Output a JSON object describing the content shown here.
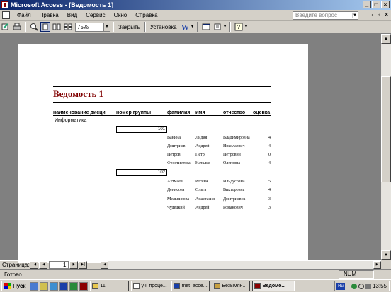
{
  "window": {
    "title": "Microsoft Access - [Ведомость 1]",
    "controls": {
      "minimize": "_",
      "maximize": "□",
      "close": "×"
    }
  },
  "menu": {
    "items": [
      "Файл",
      "Правка",
      "Вид",
      "Сервис",
      "Окно",
      "Справка"
    ],
    "ask_placeholder": "Введите вопрос",
    "window_controls": [
      "-",
      "♂",
      "×"
    ]
  },
  "toolbar": {
    "zoom_value": "75%",
    "close_label": "Закрыть",
    "setup_label": "Установка"
  },
  "report": {
    "title": "Ведомость 1",
    "headers": [
      "наименование дисци",
      "номер группы",
      "фамилия",
      "имя",
      "отчество",
      "оценка"
    ],
    "subject": "Информатика",
    "groups": [
      {
        "number": "101",
        "students": [
          {
            "last": "Ванина",
            "first": "Лидия",
            "middle": "Владимировна",
            "grade": "4"
          },
          {
            "last": "Дмитриев",
            "first": "Андрей",
            "middle": "Николаевич",
            "grade": "4"
          },
          {
            "last": "Петров",
            "first": "Петр",
            "middle": "Петрович",
            "grade": "0"
          },
          {
            "last": "Феоктистова",
            "first": "Наталья",
            "middle": "Олеговна",
            "grade": "4"
          }
        ]
      },
      {
        "number": "102",
        "students": [
          {
            "last": "Ахтмаев",
            "first": "Регина",
            "middle": "Ильдусовна",
            "grade": "5"
          },
          {
            "last": "Денисова",
            "first": "Ольга",
            "middle": "Викторовна",
            "grade": "4"
          },
          {
            "last": "Мельникова",
            "first": "Анастасия",
            "middle": "Дмитриевна",
            "grade": "3"
          },
          {
            "last": "Чудецкий",
            "first": "Андрей",
            "middle": "Романович",
            "grade": "3"
          }
        ]
      }
    ]
  },
  "pager": {
    "label": "Страница:",
    "current": "1"
  },
  "status": {
    "text": "Готово",
    "num": "NUM"
  },
  "taskbar": {
    "start": "Пуск",
    "tasks": [
      "11",
      "уч_проце...",
      "met_acce...",
      "Безымян...",
      "Ведомо..."
    ],
    "tray_lang": "Ru",
    "clock": "13:55"
  },
  "colors": {
    "title_red": "#800000",
    "titlebar_blue": "#0a246a"
  }
}
